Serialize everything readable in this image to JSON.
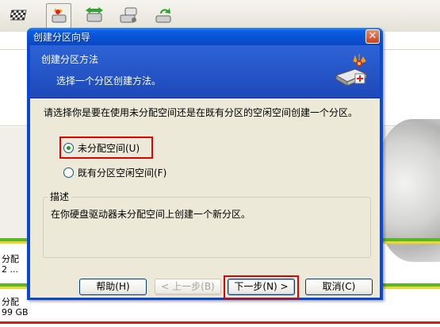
{
  "dialog": {
    "title": "创建分区向导",
    "header_title": "创建分区方法",
    "header_subtitle": "选择一个分区创建方法。",
    "instruction": "请选择你是要在使用未分配空间还是在既有分区的空闲空间创建一个分区。",
    "options": [
      {
        "label": "未分配空间(U)",
        "checked": true
      },
      {
        "label": "既有分区空闲空间(F)",
        "checked": false
      }
    ],
    "description_title": "描述",
    "description_text": "在你硬盘驱动器未分配空间上创建一个新分区。",
    "buttons": {
      "help": "帮助(H)",
      "back": "< 上一步(B)",
      "next": "下一步(N) >",
      "cancel": "取消(C)"
    }
  },
  "background": {
    "left_labels": [
      {
        "text": "分配"
      },
      {
        "text": "2 ..."
      },
      {
        "text": "分配"
      },
      {
        "text": "99 GB"
      }
    ],
    "toolbar_icons": [
      "checkered-flag-icon",
      "create-partition-icon",
      "resize-partition-icon",
      "disk-tools-icon",
      "recycle-icon"
    ]
  },
  "colors": {
    "title_blue": "#0b5fe3",
    "header_blue": "#2450c5",
    "highlight_red": "#e00000",
    "stripe_green": "#5ab527",
    "stripe_yellow": "#e8d92a"
  }
}
